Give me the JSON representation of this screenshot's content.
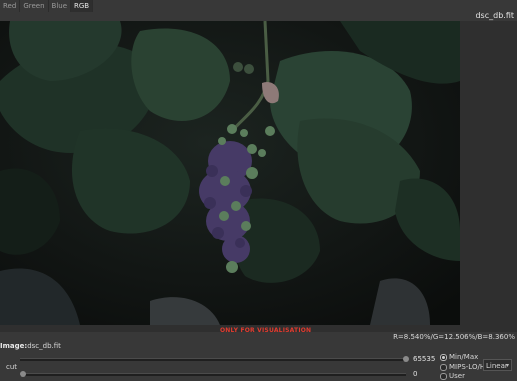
{
  "tabs": [
    {
      "label": "Red",
      "active": false
    },
    {
      "label": "Green",
      "active": false
    },
    {
      "label": "Blue",
      "active": false
    },
    {
      "label": "RGB",
      "active": true
    }
  ],
  "filename": "dsc_db.fit",
  "warning": "ONLY FOR VISUALISATION",
  "rgb_readout": "R=8.540%/G=12.506%/B=8.360%",
  "image": {
    "label": "Image:",
    "name": "dsc_db.fit"
  },
  "sliders": {
    "high_value": "65535",
    "low_value": "0",
    "cut_label": "cut"
  },
  "scale_modes": [
    {
      "label": "Min/Max",
      "selected": true
    },
    {
      "label": "MIPS-LO/HI",
      "selected": false
    },
    {
      "label": "User",
      "selected": false
    }
  ],
  "stretch": {
    "selected": "Linear"
  },
  "colors": {
    "warning": "#e23b2f",
    "leaf": "#2c4a33",
    "grape": "#4a3d6b"
  }
}
